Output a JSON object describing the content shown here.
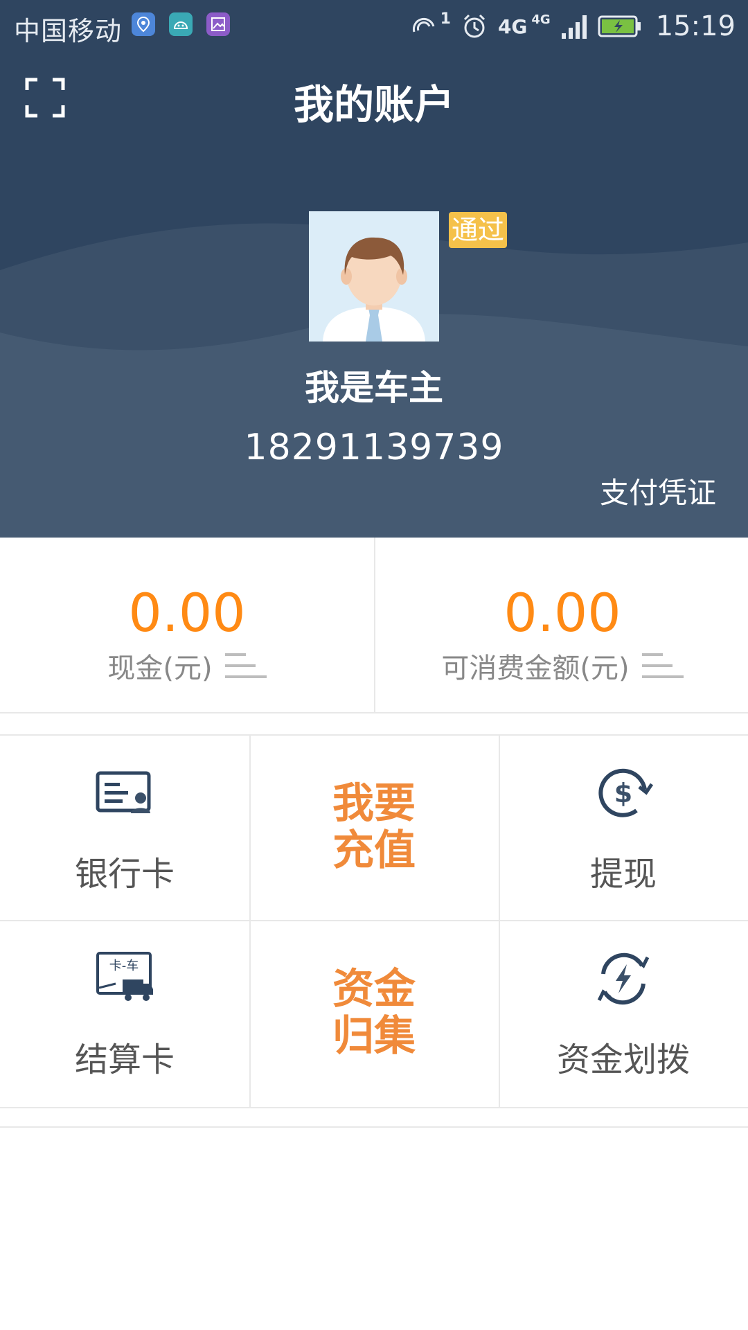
{
  "status_bar": {
    "carrier": "中国移动",
    "time": "15:19",
    "sim_label": "1",
    "network_label_1": "4G",
    "network_label_2": "4G",
    "apps": [
      "location-app-icon",
      "android-app-icon",
      "gallery-app-icon"
    ]
  },
  "header": {
    "title": "我的账户",
    "badge": "通过",
    "user_name": "我是车主",
    "phone": "18291139739",
    "voucher_link": "支付凭证"
  },
  "balances": [
    {
      "amount": "0.00",
      "label": "现金(元)"
    },
    {
      "amount": "0.00",
      "label": "可消费金额(元)"
    }
  ],
  "grid": {
    "bank_card": "银行卡",
    "recharge": [
      "我要",
      "充值"
    ],
    "withdraw": "提现",
    "settlement_card": "结算卡",
    "fund_collect": [
      "资金",
      "归集"
    ],
    "fund_transfer": "资金划拨",
    "settlement_icon_text": "卡-车"
  },
  "colors": {
    "header_bg": "#2f4560",
    "accent_orange": "#ff8a14",
    "grid_orange": "#f08a3a",
    "badge_yellow": "#f5c14a",
    "icon_navy": "#2f4560"
  }
}
